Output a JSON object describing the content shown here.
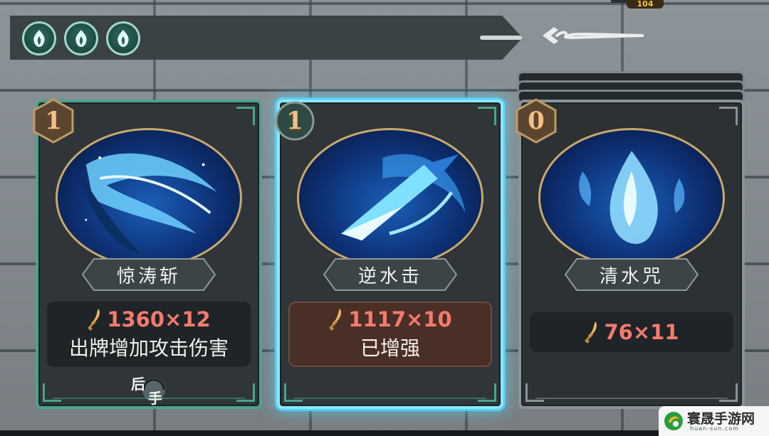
{
  "energy": {
    "count": 3,
    "icon": "flame-icon",
    "color": "#9fd8c8"
  },
  "header": {
    "back_icon": "back-arrow-icon",
    "counter": "104"
  },
  "cards": [
    {
      "cost": "1",
      "name": "惊涛斩",
      "damage": "1360×12",
      "effect": "出牌增加攻击伤害",
      "tag_a": "后",
      "tag_b": "手",
      "state": "normal",
      "art": "wave-slash"
    },
    {
      "cost": "1",
      "name": "逆水击",
      "damage": "1117×10",
      "effect": "已增强",
      "state": "selected",
      "art": "water-spear"
    },
    {
      "cost": "0",
      "name": "清水咒",
      "damage": "76×11",
      "effect": "",
      "state": "disabled",
      "art": "water-drop"
    }
  ],
  "watermark": {
    "title": "寰晟手游网",
    "url": "huan-sun.com"
  },
  "colors": {
    "jade": "#4aa38e",
    "selected_glow": "#55d0f4",
    "damage": "#f57a6e",
    "cost": "#f3c088"
  }
}
